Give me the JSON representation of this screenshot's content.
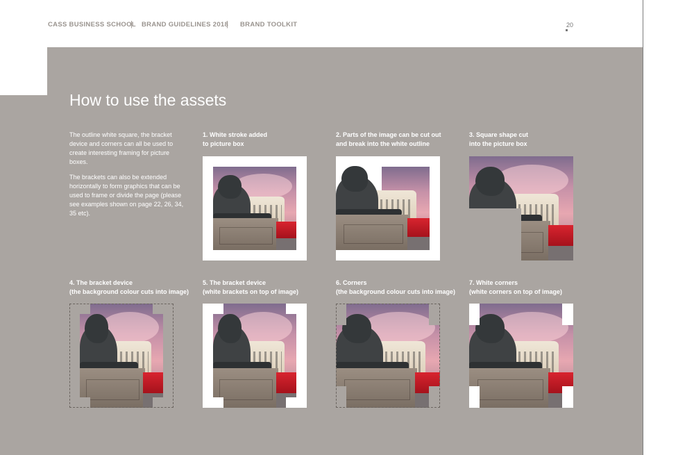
{
  "header": {
    "items": [
      "CASS BUSINESS SCHOOL",
      "BRAND GUIDELINES 2018",
      "BRAND TOOLKIT"
    ],
    "separator": "|",
    "page_number": "20"
  },
  "title": "How to use the assets",
  "intro": [
    "The outline white square, the bracket device and corners can all be used to create interesting framing for picture boxes.",
    "The brackets can also be extended horizontally to form graphics that can be used to frame or divide the page (please see examples shown on page 22, 26, 34, 35 etc)."
  ],
  "examples": [
    {
      "caption": "1. White stroke added\n   to picture box"
    },
    {
      "caption": "2. Parts of the image can be cut out\n   and break into the white outline"
    },
    {
      "caption": "3. Square shape cut\n   into the picture box"
    },
    {
      "caption": "4. The bracket device\n(the background colour cuts into image)"
    },
    {
      "caption": "5. The bracket device\n(white brackets on top of image)"
    },
    {
      "caption": "6. Corners\n(the background colour cuts into image)"
    },
    {
      "caption": "7. White corners\n(white corners on top of image)"
    }
  ],
  "colors": {
    "background_grey": "#aaa5a1",
    "white": "#ffffff",
    "header_text": "#9a948f"
  }
}
